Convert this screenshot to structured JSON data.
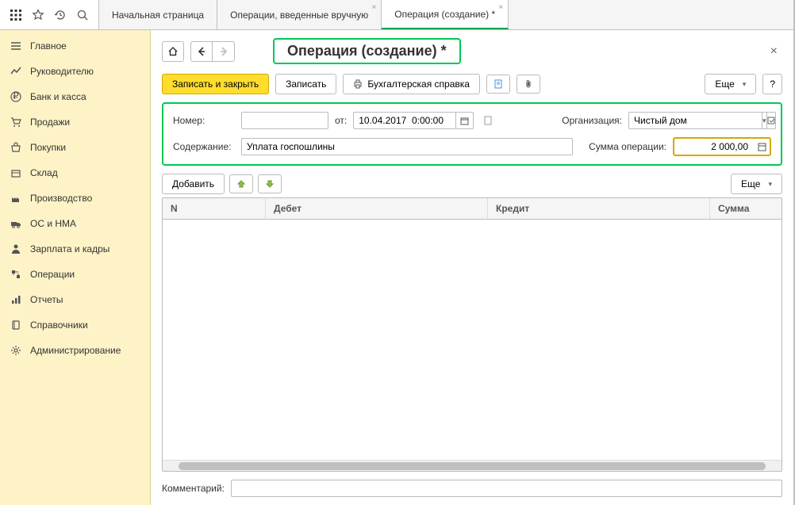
{
  "topTabs": [
    {
      "label": "Начальная страница",
      "closable": false
    },
    {
      "label": "Операции, введенные вручную",
      "closable": true
    },
    {
      "label": "Операция (создание) *",
      "closable": true,
      "active": true
    }
  ],
  "sidebar": {
    "items": [
      {
        "label": "Главное",
        "icon": "menu"
      },
      {
        "label": "Руководителю",
        "icon": "chart"
      },
      {
        "label": "Банк и касса",
        "icon": "ruble"
      },
      {
        "label": "Продажи",
        "icon": "cart"
      },
      {
        "label": "Покупки",
        "icon": "basket"
      },
      {
        "label": "Склад",
        "icon": "box"
      },
      {
        "label": "Производство",
        "icon": "factory"
      },
      {
        "label": "ОС и НМА",
        "icon": "truck"
      },
      {
        "label": "Зарплата и кадры",
        "icon": "person"
      },
      {
        "label": "Операции",
        "icon": "ops"
      },
      {
        "label": "Отчеты",
        "icon": "bars"
      },
      {
        "label": "Справочники",
        "icon": "book"
      },
      {
        "label": "Администрирование",
        "icon": "gear"
      }
    ]
  },
  "page": {
    "title": "Операция (создание) *"
  },
  "actions": {
    "saveClose": "Записать и закрыть",
    "save": "Записать",
    "accReport": "Бухгалтерская справка",
    "more": "Еще",
    "help": "?"
  },
  "form": {
    "numberLabel": "Номер:",
    "numberValue": "",
    "fromLabel": "от:",
    "dateValue": "10.04.2017  0:00:00",
    "orgLabel": "Организация:",
    "orgValue": "Чистый дом",
    "contentLabel": "Содержание:",
    "contentValue": "Уплата госпошлины",
    "sumLabel": "Сумма операции:",
    "sumValue": "2 000,00"
  },
  "tableToolbar": {
    "add": "Добавить",
    "more": "Еще"
  },
  "table": {
    "cols": {
      "n": "N",
      "debit": "Дебет",
      "credit": "Кредит",
      "sum": "Сумма"
    }
  },
  "comment": {
    "label": "Комментарий:",
    "value": ""
  }
}
